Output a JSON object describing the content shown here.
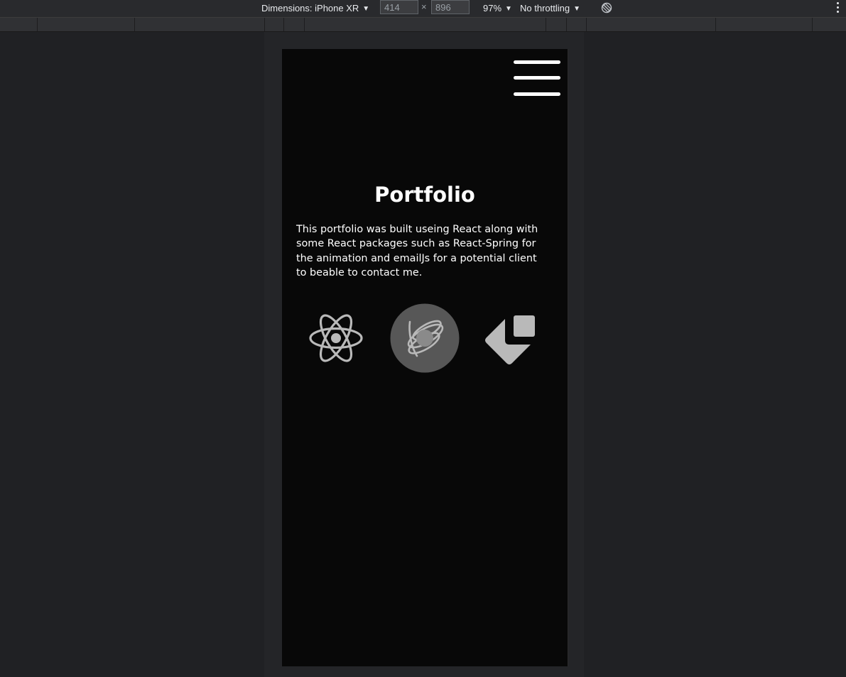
{
  "devtools": {
    "dimensions_label": "Dimensions: iPhone XR",
    "width_value": "414",
    "times": "×",
    "height_value": "896",
    "zoom": "97%",
    "throttling": "No throttling"
  },
  "page": {
    "title": "Portfolio",
    "description": "This portfolio was built useing React along with some React packages such as React-Spring for the animation and emailJs for a potential client to beable to contact me."
  },
  "icons": {
    "nav": "hamburger-menu-icon",
    "tech": [
      "react-icon",
      "react-spring-icon",
      "emailjs-icon"
    ]
  },
  "colors": {
    "background": "#080808",
    "text": "#ffffff",
    "icon_gray": "#b9b9b9",
    "spring_circle": "#575757"
  }
}
